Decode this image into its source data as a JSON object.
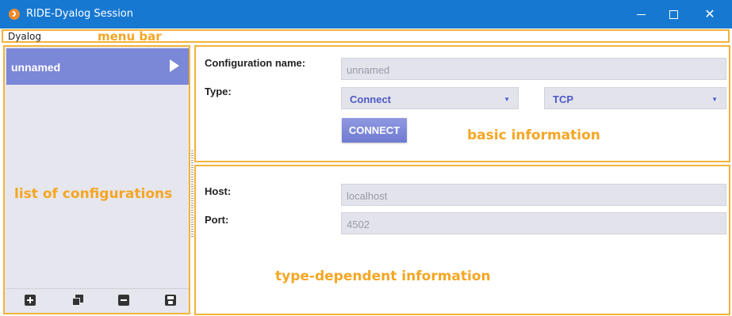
{
  "window": {
    "title": "RIDE-Dyalog Session",
    "close_glyph": "✕"
  },
  "menubar": {
    "items": [
      "Dyalog"
    ],
    "annotation": "menu bar"
  },
  "config_list": {
    "items": [
      {
        "label": "unnamed",
        "selected": true
      }
    ],
    "annotation": "list of configurations",
    "toolbar_icons": [
      "add-icon",
      "clone-icon",
      "remove-icon",
      "save-icon"
    ]
  },
  "basic_info": {
    "config_name_label": "Configuration name:",
    "config_name_value": "unnamed",
    "type_label": "Type:",
    "type_value": "Connect",
    "protocol_value": "TCP",
    "connect_button": "CONNECT",
    "annotation": "basic information"
  },
  "type_info": {
    "host_label": "Host:",
    "host_value": "localhost",
    "port_label": "Port:",
    "port_value": "4502",
    "annotation": "type-dependent information"
  },
  "colors": {
    "titlebar": "#1778d2",
    "annotation": "#f5a623",
    "selected_item": "#7b87d7",
    "accent_text": "#4d59c4"
  }
}
